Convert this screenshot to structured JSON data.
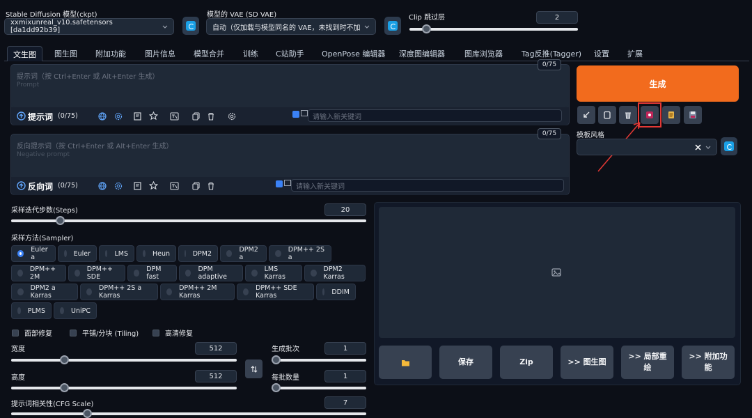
{
  "header": {
    "ckpt_label": "Stable Diffusion 模型(ckpt)",
    "ckpt_value": "xxmixunreal_v10.safetensors [da1dd92b39]",
    "vae_label": "模型的 VAE (SD VAE)",
    "vae_value": "自动（仅加载与模型同名的 VAE，未找到时不加",
    "clip_label": "Clip 跳过层",
    "clip_value": "2",
    "clip_fraction": 0.0
  },
  "tabs": [
    "文生图",
    "图生图",
    "附加功能",
    "图片信息",
    "模型合并",
    "训练",
    "C站助手",
    "OpenPose 编辑器",
    "深度图编辑器",
    "图库浏览器",
    "Tag反推(Tagger)",
    "设置",
    "扩展"
  ],
  "prompt": {
    "placeholder": "提示词（按 Ctrl+Enter 或 Alt+Enter 生成）",
    "placeholder_en": "Prompt",
    "counter": "0/75",
    "title": "提示词",
    "count": "(0/75)",
    "keyword_placeholder": "请输入新关键词"
  },
  "negative": {
    "placeholder": "反向提示词（按 Ctrl+Enter 或 Alt+Enter 生成）",
    "placeholder_en": "Negative prompt",
    "counter": "0/75",
    "title": "反向词",
    "count": "(0/75)",
    "keyword_placeholder": "请输入新关键词"
  },
  "generate": {
    "label": "生成",
    "style_label": "模板风格",
    "accent": "#f26b1d"
  },
  "steps": {
    "label": "采样迭代步数(Steps)",
    "value": "20",
    "fraction": 0.15
  },
  "sampler": {
    "label": "采样方法(Sampler)",
    "options": [
      "Euler a",
      "Euler",
      "LMS",
      "Heun",
      "DPM2",
      "DPM2 a",
      "DPM++ 2S a",
      "DPM++ 2M",
      "DPM++ SDE",
      "DPM fast",
      "DPM adaptive",
      "LMS Karras",
      "DPM2 Karras",
      "DPM2 a Karras",
      "DPM++ 2S a Karras",
      "DPM++ 2M Karras",
      "DPM++ SDE Karras",
      "DDIM",
      "PLMS",
      "UniPC"
    ],
    "selected": "Euler a"
  },
  "checks": [
    "面部修复",
    "平铺/分块 (Tiling)",
    "高清修复"
  ],
  "width": {
    "label": "宽度",
    "value": "512",
    "fraction": 0.23
  },
  "height": {
    "label": "高度",
    "value": "512",
    "fraction": 0.23
  },
  "batch_count": {
    "label": "生成批次",
    "value": "1",
    "fraction": 0.0
  },
  "batch_size": {
    "label": "每批数量",
    "value": "1",
    "fraction": 0.0
  },
  "cfg": {
    "label": "提示词相关性(CFG Scale)",
    "value": "7",
    "fraction": 0.2
  },
  "output_buttons": {
    "save": "保存",
    "zip": "Zip",
    "to_img2img": ">> 图生图",
    "inpaint": ">> 局部重绘",
    "extras": ">> 附加功能"
  }
}
